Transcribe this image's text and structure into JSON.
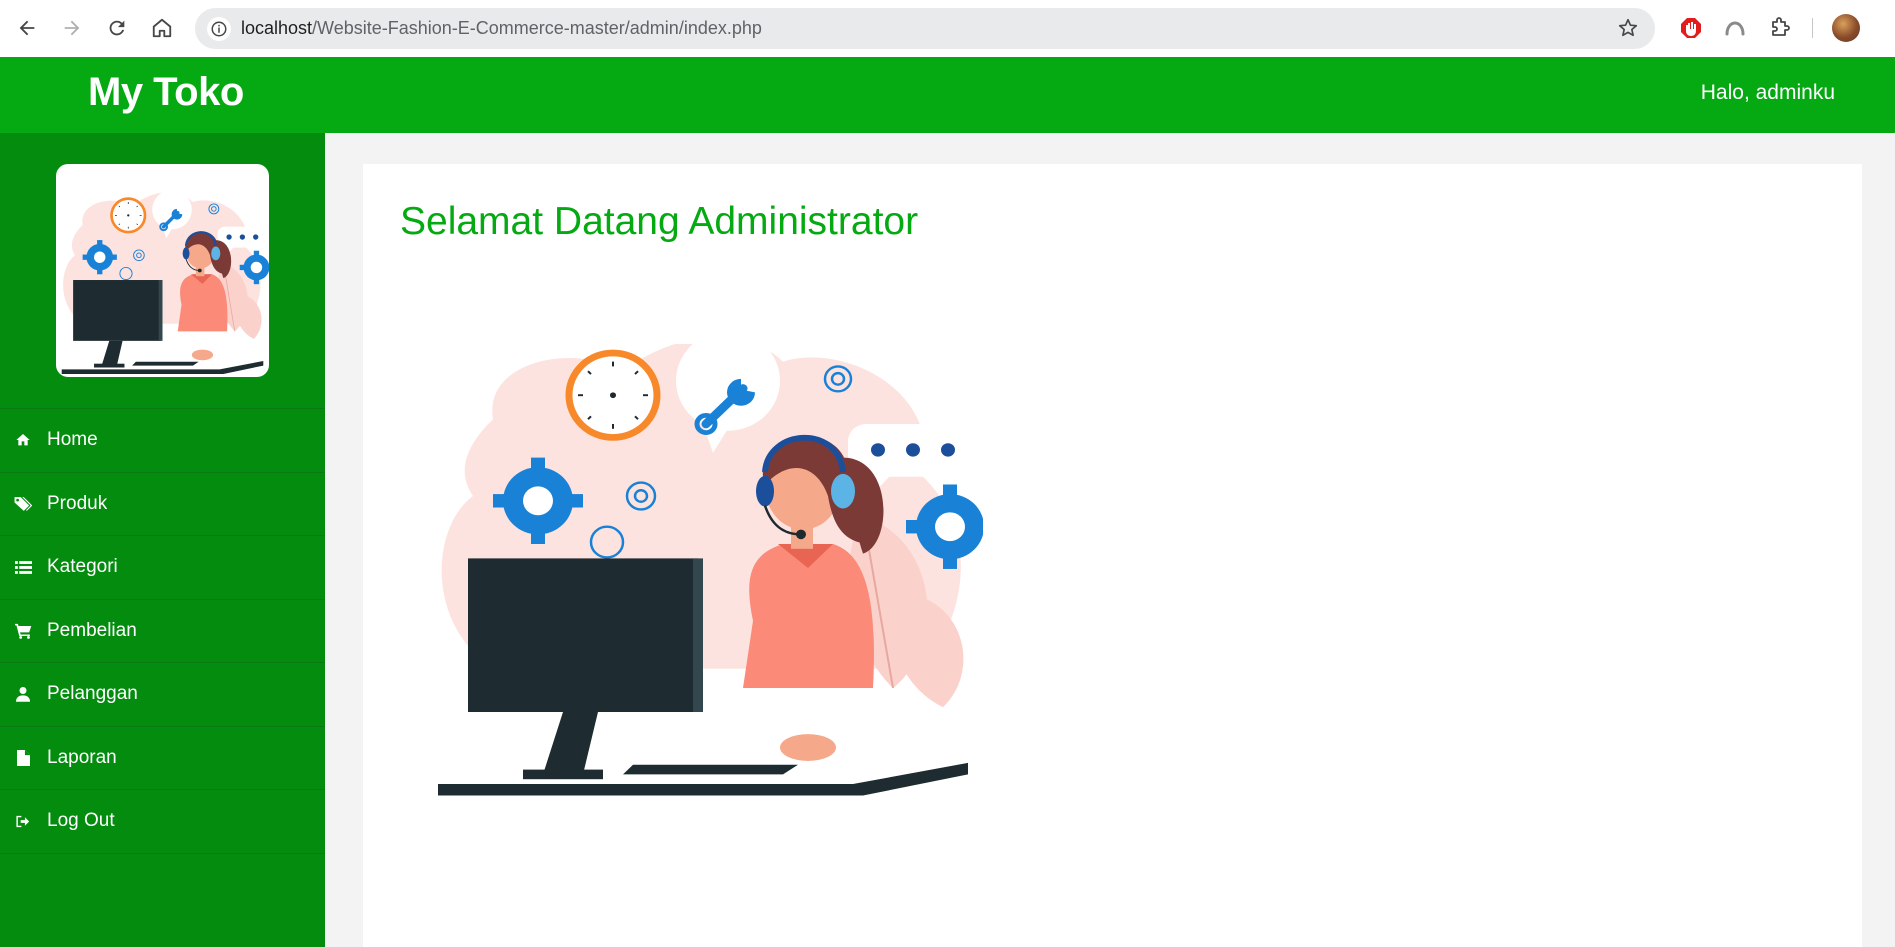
{
  "browser": {
    "url_host": "localhost",
    "url_path": "/Website-Fashion-E-Commerce-master/admin/index.php"
  },
  "header": {
    "brand": "My Toko",
    "greeting": "Halo, adminku"
  },
  "sidebar": {
    "items": [
      {
        "label": "Home",
        "icon": "home-icon"
      },
      {
        "label": "Produk",
        "icon": "tags-icon"
      },
      {
        "label": "Kategori",
        "icon": "list-icon"
      },
      {
        "label": "Pembelian",
        "icon": "cart-icon"
      },
      {
        "label": "Pelanggan",
        "icon": "user-icon"
      },
      {
        "label": "Laporan",
        "icon": "file-icon"
      },
      {
        "label": "Log Out",
        "icon": "logout-icon"
      }
    ]
  },
  "main": {
    "title": "Selamat Datang Administrator"
  },
  "colors": {
    "header_green": "#05aa12",
    "sidebar_green": "#048c0e",
    "title_green": "#05aa12"
  }
}
